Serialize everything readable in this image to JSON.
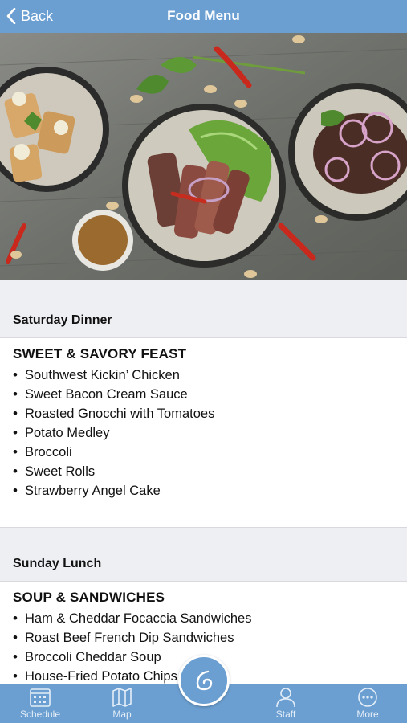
{
  "nav": {
    "back_label": "Back",
    "title": "Food Menu"
  },
  "hero": {
    "image": "plated food dishes on wooden table"
  },
  "sections": [
    {
      "header": "Saturday Dinner",
      "title": "SWEET & SAVORY FEAST",
      "items": [
        "Southwest Kickin’ Chicken",
        "Sweet Bacon Cream Sauce",
        "Roasted Gnocchi with Tomatoes",
        "Potato Medley",
        "Broccoli",
        "Sweet Rolls",
        "Strawberry Angel Cake"
      ]
    },
    {
      "header": "Sunday Lunch",
      "title": "SOUP & SANDWICHES",
      "items": [
        "Ham & Cheddar Focaccia Sandwiches",
        "Roast Beef French Dip Sandwiches",
        "Broccoli Cheddar Soup",
        "House-Fried Potato Chips"
      ]
    }
  ],
  "tabbar": {
    "items": [
      {
        "label": "Schedule",
        "icon": "calendar-icon"
      },
      {
        "label": "Map",
        "icon": "map-icon"
      },
      {
        "label": "Staff",
        "icon": "person-icon"
      },
      {
        "label": "More",
        "icon": "more-dots-icon"
      }
    ],
    "center_icon": "logo-icon"
  },
  "colors": {
    "accent": "#6b9fd1",
    "section_bg": "#eeeff3"
  }
}
